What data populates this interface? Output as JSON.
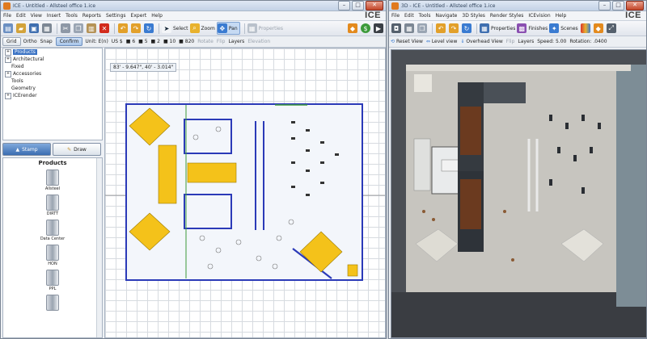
{
  "win2d": {
    "title": "ICE - Untitled - Allsteel office 1.ice",
    "menu": [
      "File",
      "Edit",
      "View",
      "Insert",
      "Tools",
      "Reports",
      "Settings",
      "Expert",
      "Help"
    ],
    "brand": "ICE",
    "toolbar": {
      "select_label": "Select",
      "zoom_label": "Zoom",
      "pan_label": "Pan",
      "properties_label": "Properties"
    },
    "toolbar2": {
      "grid": "Grid",
      "ortho": "Ortho",
      "snap": "Snap",
      "confirm": "Confirm",
      "unit": "Unit: E(n)",
      "currency": "US $",
      "count_a": "6",
      "count_b": "5",
      "count_c": "2",
      "count_d": "10",
      "count_e": "820",
      "rotate": "Rotate",
      "flip": "Flip",
      "layers": "Layers",
      "elevation": "Elevation"
    },
    "tree": [
      {
        "label": "Products",
        "expand": true,
        "selected": true
      },
      {
        "label": "Architectural",
        "expand": true
      },
      {
        "label": "Fixed",
        "expand": false
      },
      {
        "label": "Accessories",
        "expand": true
      },
      {
        "label": "Tools",
        "expand": false
      },
      {
        "label": "Geometry",
        "expand": false
      },
      {
        "label": "ICErender",
        "expand": true
      }
    ],
    "stamp_label": "Stamp",
    "draw_label": "Draw",
    "products_title": "Products",
    "products": [
      "Allsteel",
      "DIRTT",
      "Data Center",
      "HON",
      "PPL"
    ],
    "coord_readout": "83' - 9.647\", 40' - 3.014\""
  },
  "win3d": {
    "title": "3D - ICE - Untitled - Allsteel office 1.ice",
    "menu": [
      "File",
      "Edit",
      "Tools",
      "Navigate",
      "3D Styles",
      "Render Styles",
      "ICEvision",
      "Help"
    ],
    "brand": "ICE",
    "toolbar": {
      "properties_label": "Properties",
      "finishes_label": "Finishes",
      "scenes_label": "Scenes"
    },
    "toolbar2": {
      "reset_view": "Reset View",
      "level_view": "Level view",
      "overhead_view": "Overhead View",
      "flip": "Flip",
      "layers": "Layers",
      "speed": "Speed: 5.00",
      "rotation": "Rotation: .0400"
    }
  },
  "colors": {
    "accent": "#3b6db1",
    "wall": "#2b3ab8",
    "table": "#f4c21a",
    "floor3d": "#c7c5bf"
  }
}
